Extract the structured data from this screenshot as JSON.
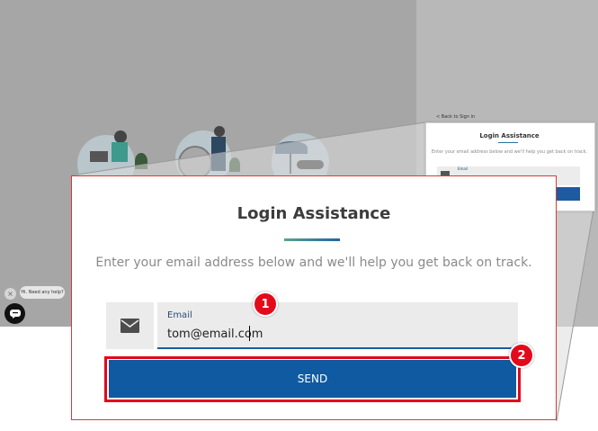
{
  "mini_card": {
    "back_link": "< Back to Sign in",
    "title": "Login Assistance",
    "description": "Enter your email address below and we'll help you get back on track.",
    "field_label": "Email"
  },
  "card": {
    "title": "Login Assistance",
    "description": "Enter your email address below and we'll help you get back on track.",
    "email_label": "Email",
    "email_value": "tom@email.com",
    "send_label": "SEND"
  },
  "annotations": {
    "badge_1": "1",
    "badge_2": "2"
  },
  "chat": {
    "close_label": "×",
    "bubble_text": "Hi. Need any help?"
  },
  "colors": {
    "primary_button": "#0f5aa0",
    "highlight_border": "#e2071c",
    "badge": "#e30b1b",
    "backdrop": "#a6a6a6"
  },
  "icons": {
    "email_field": "envelope-icon",
    "chat": "chat-icon",
    "close": "close-icon"
  }
}
